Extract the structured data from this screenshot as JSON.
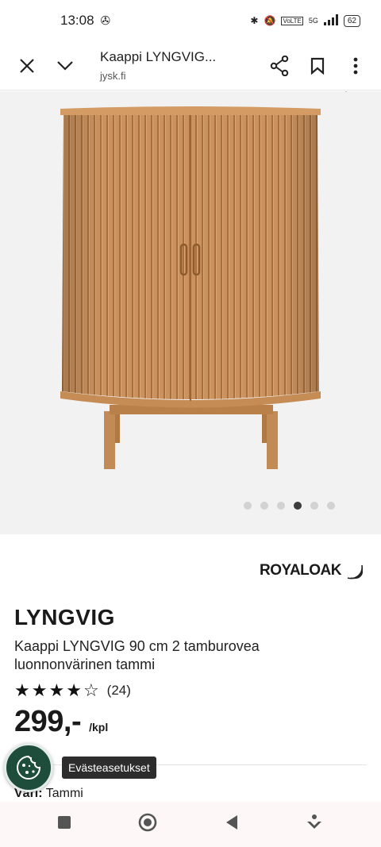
{
  "status_bar": {
    "time": "13:08",
    "battery": "62",
    "network": "5G"
  },
  "browser": {
    "page_title": "Kaappi LYNGVIG...",
    "host": "jysk.fi"
  },
  "gallery": {
    "image_count": 6,
    "active_index": 3
  },
  "brand": {
    "name": "ROYALOAK"
  },
  "product": {
    "name": "LYNGVIG",
    "description": "Kaappi LYNGVIG 90 cm 2 tamburovea luonnonvärinen tammi",
    "rating_value": 4,
    "rating_max": 5,
    "review_count": "(24)",
    "price": "299,-",
    "price_unit": "/kpl",
    "color_label": "Väri:",
    "color_value": "Tammi"
  },
  "cookie": {
    "tooltip": "Evästeasetukset"
  },
  "colors": {
    "cabinet": "#c98f5a",
    "cabinet_dark": "#b07842",
    "cookie_fab": "#1f4d3c"
  }
}
